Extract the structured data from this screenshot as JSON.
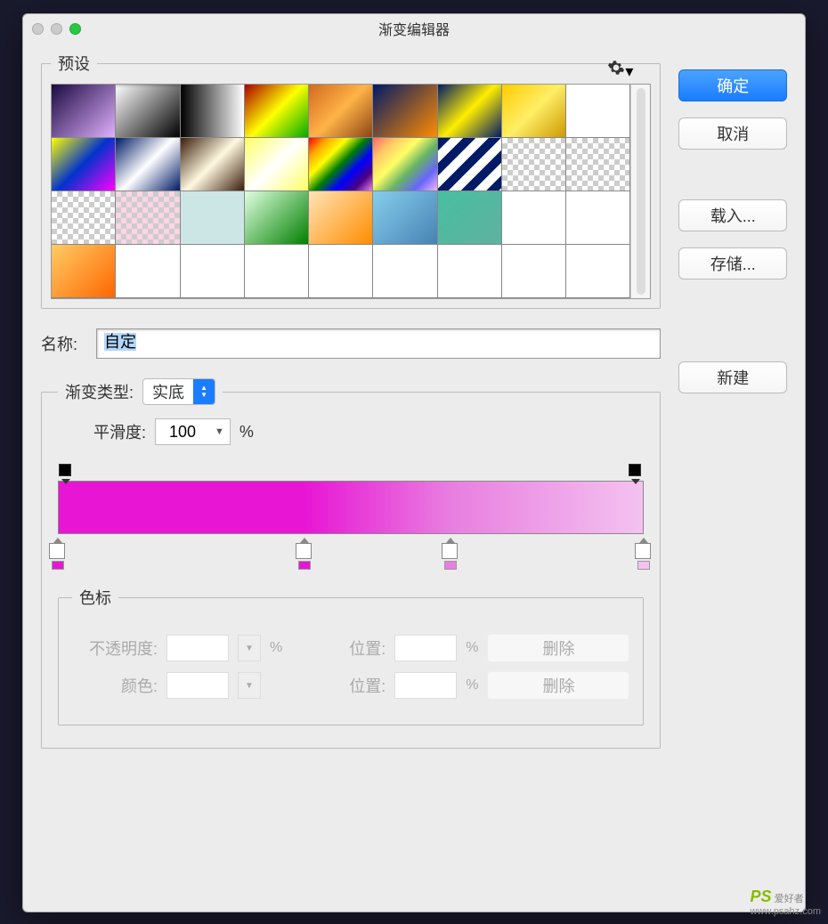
{
  "window": {
    "title": "渐变编辑器"
  },
  "buttons": {
    "ok": "确定",
    "cancel": "取消",
    "load": "载入...",
    "save": "存储...",
    "new": "新建",
    "delete1": "删除",
    "delete2": "删除"
  },
  "presets": {
    "legend": "预设",
    "swatches": [
      "linear-gradient(135deg,#1a0a40,#e0b0ff)",
      "linear-gradient(135deg,rgba(0,0,0,0),#000)",
      "linear-gradient(to right,#000,#fff)",
      "linear-gradient(135deg,#a00,#ff0,#0a0)",
      "linear-gradient(135deg,#d2691e,#ffb347,#8b4513)",
      "linear-gradient(135deg,#001a66,#ff8c00)",
      "linear-gradient(135deg,#001a66,#ffee00,#001a66)",
      "linear-gradient(135deg,#ffcc00,#ffee66,#cc9900)",
      "#fff",
      "linear-gradient(135deg,#ff0,#0033cc,#f0f)",
      "linear-gradient(135deg,#001a66,#fff,#001a66)",
      "linear-gradient(135deg,#3a1e0a,#fff8e0,#3a1e0a)",
      "linear-gradient(135deg,#ff6,#fff,#ff6)",
      "linear-gradient(135deg,red,orange,yellow,green,blue,indigo,violet)",
      "linear-gradient(135deg,rgba(255,0,0,0.6),rgba(255,165,0,0.6),rgba(255,255,0,0.6),rgba(0,128,0,0.6),rgba(0,0,255,0.6),rgba(238,130,238,0.6))",
      "repeating-linear-gradient(135deg,#001a66 0 10px,#fff 10px 20px)",
      "checker",
      "checker",
      "checker",
      "checker-pink",
      "#cce6e6",
      "linear-gradient(135deg,#e0ffe0,#008000)",
      "linear-gradient(135deg,#ffe4b5,#ff8c00)",
      "linear-gradient(135deg,#87ceeb,#4682b4)",
      "linear-gradient(135deg,#48bfa0,#5fb1a0)",
      "#fff",
      "#fff",
      "linear-gradient(135deg,#ffcc66,#ff6600)"
    ]
  },
  "name": {
    "label": "名称:",
    "value": "自定"
  },
  "gradient": {
    "typeLabel": "渐变类型:",
    "typeValue": "实底",
    "smoothLabel": "平滑度:",
    "smoothValue": "100",
    "pct": "%",
    "colorStops": [
      {
        "pos": 0,
        "color": "#e815d4"
      },
      {
        "pos": 42,
        "color": "#e815d4"
      },
      {
        "pos": 67,
        "color": "#e87ee0"
      },
      {
        "pos": 100,
        "color": "#f4c2f0"
      }
    ]
  },
  "stops": {
    "legend": "色标",
    "opacityLabel": "不透明度:",
    "posLabel": "位置:",
    "colorLabel": "颜色:",
    "pct": "%"
  },
  "watermark": {
    "brand": "PS",
    "text": "爱好者",
    "url": "www.psahz.com"
  }
}
